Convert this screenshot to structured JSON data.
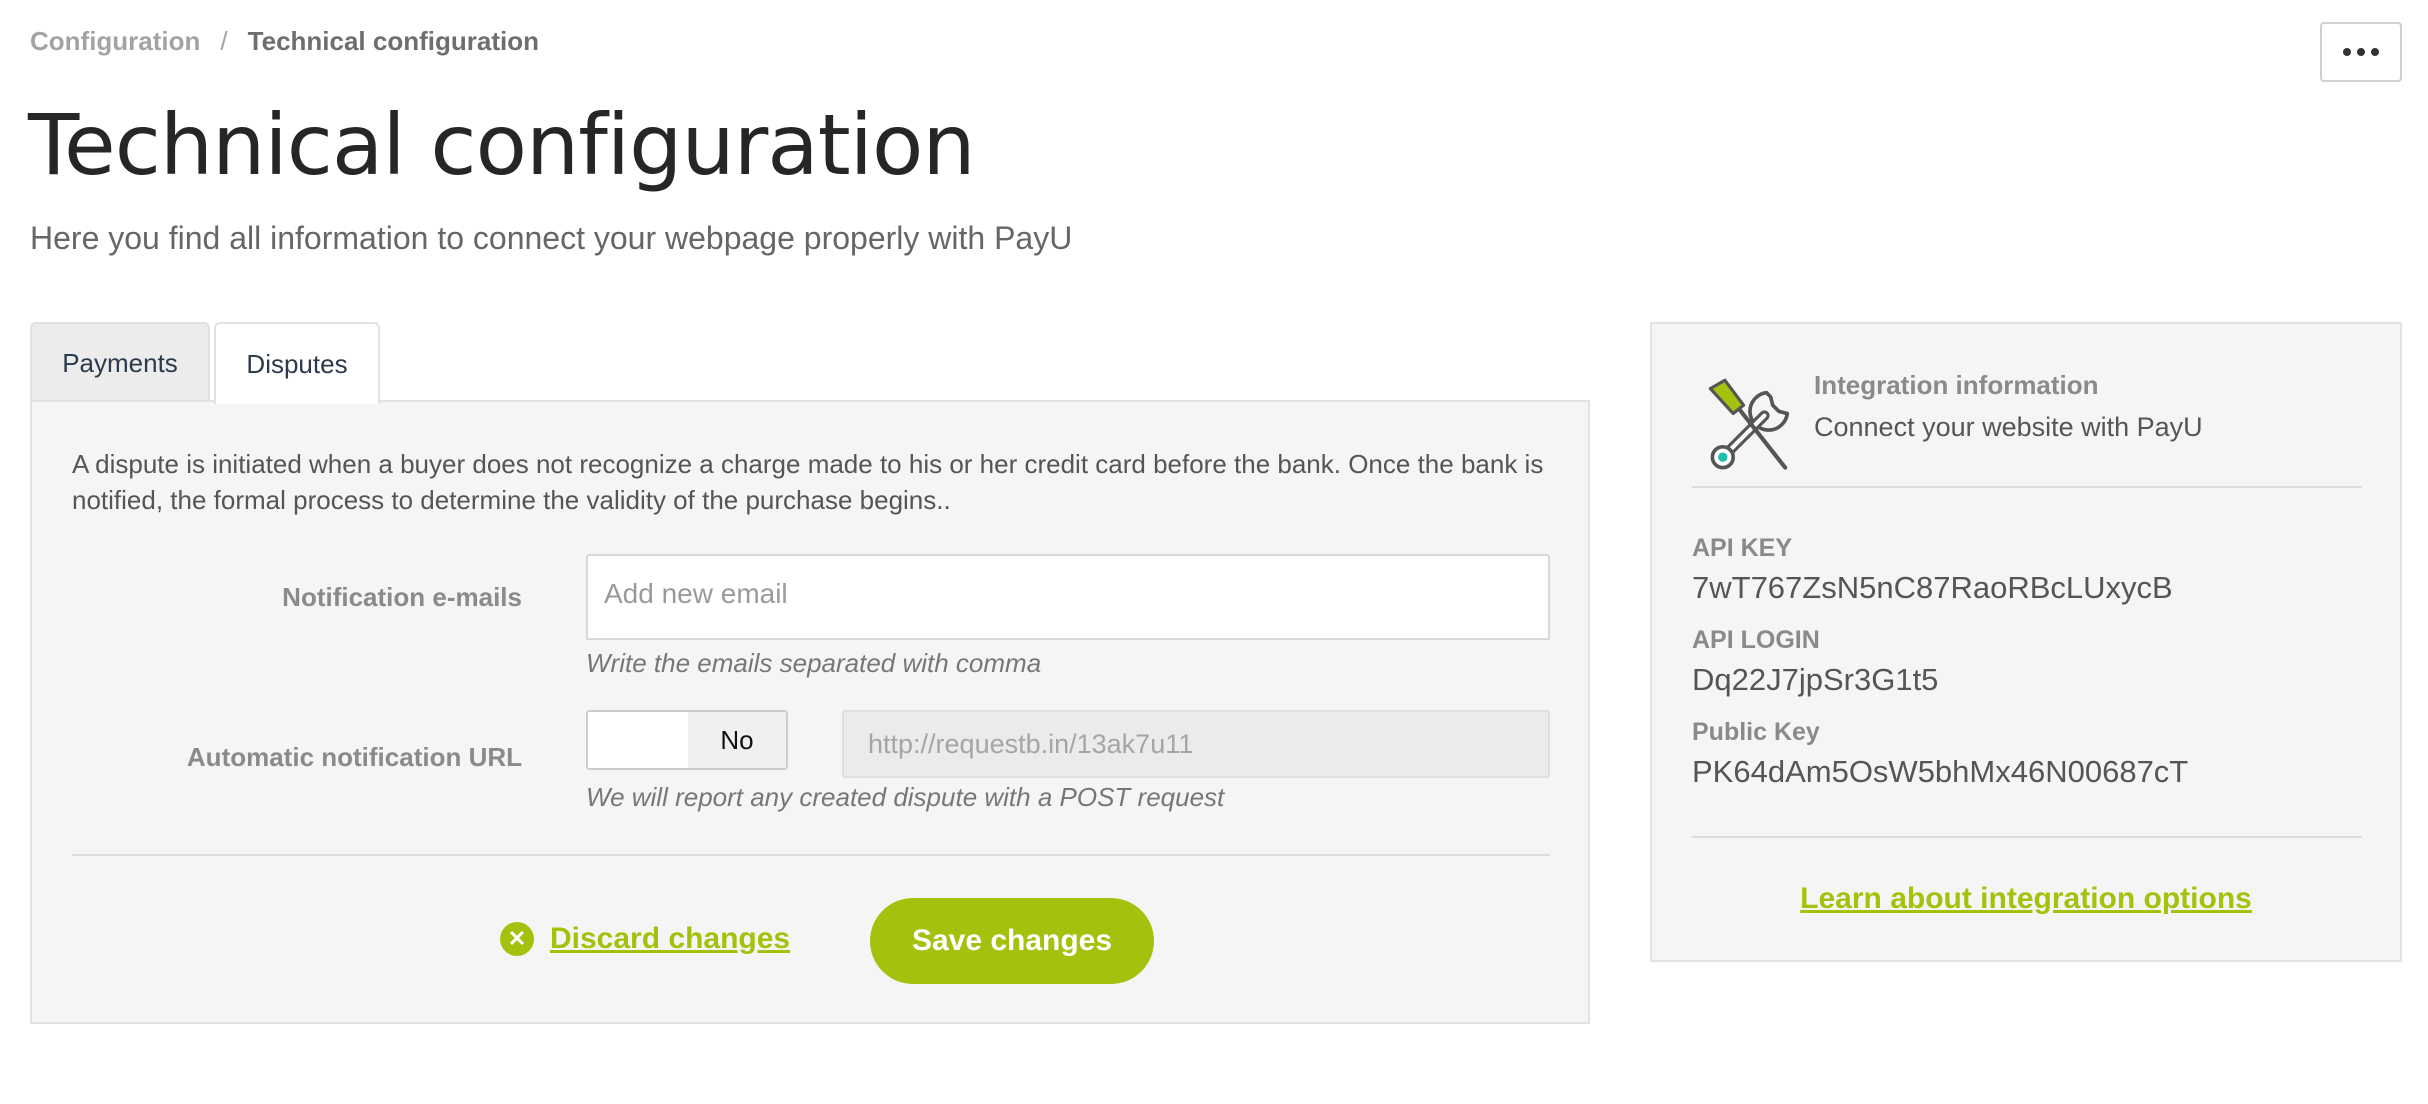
{
  "breadcrumb": {
    "parent": "Configuration",
    "separator": "/",
    "current": "Technical configuration"
  },
  "header": {
    "title": "Technical configuration",
    "subtitle": "Here you find all information to connect your webpage properly with PayU",
    "more_icon": "ellipsis-icon"
  },
  "tabs": [
    {
      "label": "Payments",
      "active": false
    },
    {
      "label": "Disputes",
      "active": true
    }
  ],
  "disputes": {
    "description": "A dispute is initiated when a buyer does not recognize a charge made to his or her credit card before the bank. Once the bank is notified, the formal process to determine the validity of the purchase begins..",
    "emails": {
      "label": "Notification e-mails",
      "placeholder": "Add new email",
      "value": "",
      "help": "Write the emails separated with comma"
    },
    "url": {
      "label": "Automatic notification URL",
      "toggle_value": "No",
      "placeholder": "http://requestb.in/13ak7u11",
      "help": "We will report any created dispute with a POST request"
    },
    "actions": {
      "discard_label": "Discard changes",
      "save_label": "Save changes"
    }
  },
  "integration": {
    "icon": "tools-icon",
    "title": "Integration information",
    "subtitle": "Connect your website with PayU",
    "api_key_label": "API KEY",
    "api_key": "7wT767ZsN5nC87RaoRBcLUxycB",
    "api_login_label": "API LOGIN",
    "api_login": "Dq22J7jpSr3G1t5",
    "public_key_label": "Public Key",
    "public_key": "PK64dAm5OsW5bhMx46N00687cT",
    "link": "Learn about integration options"
  },
  "colors": {
    "accent": "#a5c10e",
    "teal": "#1fbcb0"
  }
}
